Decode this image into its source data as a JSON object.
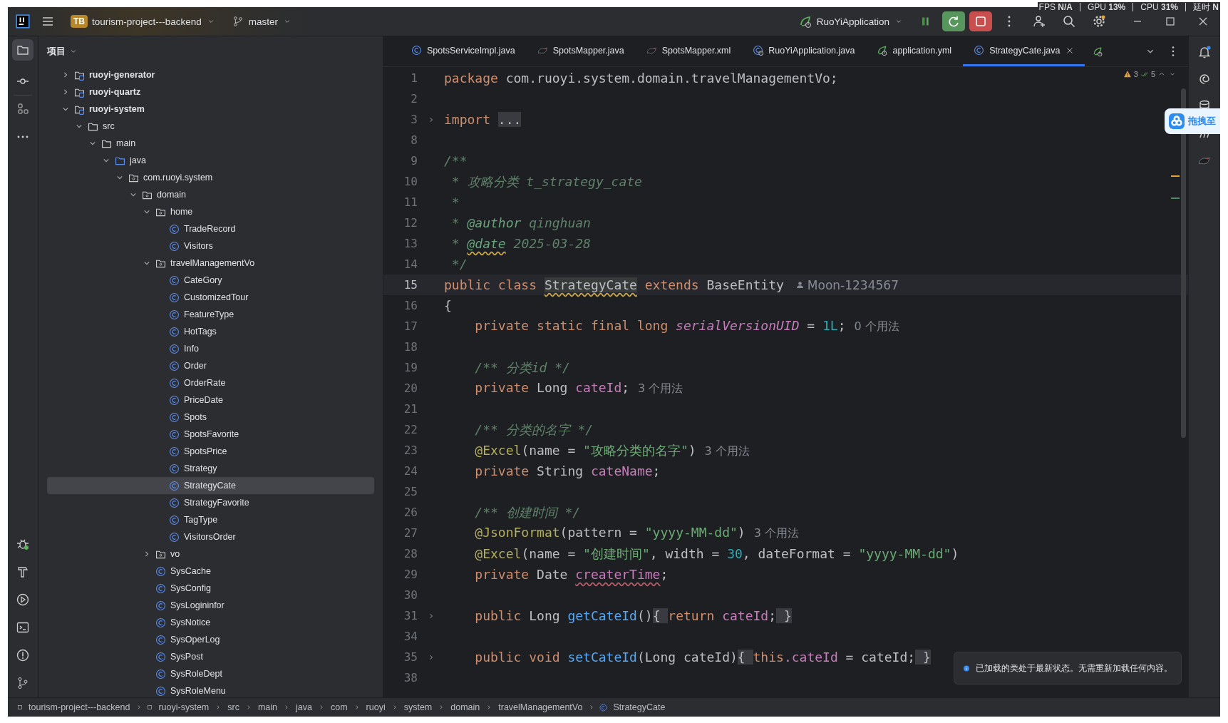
{
  "title_bar": {
    "project_badge": "TB",
    "project": "tourism-project---backend",
    "branch": "master",
    "run_config": "RuoYiApplication",
    "stats": [
      {
        "label": "FPS",
        "value": "N/A"
      },
      {
        "label": "GPU",
        "value": "13%"
      },
      {
        "label": "CPU",
        "value": "31%"
      },
      {
        "label": "延时",
        "value": "N"
      }
    ]
  },
  "project_panel": {
    "title": "项目",
    "tree": [
      {
        "label": "ruoyi-generator",
        "kind": "module",
        "expanded": false
      },
      {
        "label": "ruoyi-quartz",
        "kind": "module",
        "expanded": false
      },
      {
        "label": "ruoyi-system",
        "kind": "module",
        "expanded": true,
        "children": [
          {
            "label": "src",
            "kind": "folder",
            "expanded": true,
            "children": [
              {
                "label": "main",
                "kind": "folder",
                "expanded": true,
                "children": [
                  {
                    "label": "java",
                    "kind": "source",
                    "expanded": true,
                    "children": [
                      {
                        "label": "com.ruoyi.system",
                        "kind": "package",
                        "expanded": true,
                        "children": [
                          {
                            "label": "domain",
                            "kind": "package",
                            "expanded": true,
                            "children": [
                              {
                                "label": "home",
                                "kind": "package",
                                "expanded": true,
                                "children": [
                                  {
                                    "label": "TradeRecord",
                                    "kind": "class",
                                    "selected": false
                                  },
                                  {
                                    "label": "Visitors",
                                    "kind": "class",
                                    "selected": false
                                  }
                                ]
                              },
                              {
                                "label": "travelManagementVo",
                                "kind": "package",
                                "expanded": true,
                                "children": [
                                  {
                                    "label": "CateGory",
                                    "kind": "class",
                                    "selected": false
                                  },
                                  {
                                    "label": "CustomizedTour",
                                    "kind": "class",
                                    "selected": false
                                  },
                                  {
                                    "label": "FeatureType",
                                    "kind": "class",
                                    "selected": false
                                  },
                                  {
                                    "label": "HotTags",
                                    "kind": "class",
                                    "selected": false
                                  },
                                  {
                                    "label": "Info",
                                    "kind": "class",
                                    "selected": false
                                  },
                                  {
                                    "label": "Order",
                                    "kind": "class",
                                    "selected": false
                                  },
                                  {
                                    "label": "OrderRate",
                                    "kind": "class",
                                    "selected": false
                                  },
                                  {
                                    "label": "PriceDate",
                                    "kind": "class",
                                    "selected": false
                                  },
                                  {
                                    "label": "Spots",
                                    "kind": "class",
                                    "selected": false
                                  },
                                  {
                                    "label": "SpotsFavorite",
                                    "kind": "class",
                                    "selected": false
                                  },
                                  {
                                    "label": "SpotsPrice",
                                    "kind": "class",
                                    "selected": false
                                  },
                                  {
                                    "label": "Strategy",
                                    "kind": "class",
                                    "selected": false
                                  },
                                  {
                                    "label": "StrategyCate",
                                    "kind": "class",
                                    "selected": true
                                  },
                                  {
                                    "label": "StrategyFavorite",
                                    "kind": "class",
                                    "selected": false
                                  },
                                  {
                                    "label": "TagType",
                                    "kind": "class",
                                    "selected": false
                                  },
                                  {
                                    "label": "VisitorsOrder",
                                    "kind": "class",
                                    "selected": false
                                  }
                                ]
                              },
                              {
                                "label": "vo",
                                "kind": "package",
                                "expanded": false
                              },
                              {
                                "label": "SysCache",
                                "kind": "class",
                                "selected": false
                              },
                              {
                                "label": "SysConfig",
                                "kind": "class",
                                "selected": false
                              },
                              {
                                "label": "SysLogininfor",
                                "kind": "class",
                                "selected": false
                              },
                              {
                                "label": "SysNotice",
                                "kind": "class",
                                "selected": false
                              },
                              {
                                "label": "SysOperLog",
                                "kind": "class",
                                "selected": false
                              },
                              {
                                "label": "SysPost",
                                "kind": "class",
                                "selected": false
                              },
                              {
                                "label": "SysRoleDept",
                                "kind": "class",
                                "selected": false
                              },
                              {
                                "label": "SysRoleMenu",
                                "kind": "class",
                                "selected": false
                              }
                            ]
                          }
                        ]
                      }
                    ]
                  }
                ]
              }
            ]
          }
        ]
      }
    ]
  },
  "tabs": [
    {
      "label": "SpotsServiceImpl.java",
      "kind": "class",
      "selected": false
    },
    {
      "label": "SpotsMapper.java",
      "kind": "bird",
      "selected": false
    },
    {
      "label": "SpotsMapper.xml",
      "kind": "bird",
      "selected": false
    },
    {
      "label": "RuoYiApplication.java",
      "kind": "spring-class",
      "selected": false
    },
    {
      "label": "application.yml",
      "kind": "spring",
      "selected": false
    },
    {
      "label": "StrategyCate.java",
      "kind": "class",
      "selected": true
    }
  ],
  "editor": {
    "warnings": "3",
    "checks": "5",
    "lines": [
      {
        "number": "1",
        "folded": false,
        "current": false,
        "nested": false,
        "tokens": [
          {
            "kind": "keyword",
            "text": "package"
          },
          {
            "kind": "plain",
            "text": " com.ruoyi.system.domain.travelManagementVo;"
          }
        ]
      },
      {
        "number": "2",
        "folded": false,
        "current": false
      },
      {
        "number": "3",
        "folded": true,
        "current": false,
        "nested": false,
        "tokens": [
          {
            "kind": "keyword",
            "text": "import "
          },
          {
            "kind": "fold-box",
            "text": "..."
          }
        ]
      },
      {
        "number": "8",
        "folded": false,
        "current": false
      },
      {
        "number": "9",
        "folded": false,
        "current": false,
        "nested": false,
        "tokens": [
          {
            "kind": "doc",
            "text": "/**"
          }
        ]
      },
      {
        "number": "10",
        "folded": false,
        "current": false,
        "nested": false,
        "tokens": [
          {
            "kind": "doc",
            "text": " * 攻略分类 t_strategy_cate"
          }
        ]
      },
      {
        "number": "11",
        "folded": false,
        "current": false,
        "nested": false,
        "tokens": [
          {
            "kind": "doc",
            "text": " *"
          }
        ]
      },
      {
        "number": "12",
        "folded": false,
        "current": false,
        "nested": false,
        "tokens": [
          {
            "kind": "doc",
            "text": " * "
          },
          {
            "kind": "doc-tag",
            "text": "@author"
          },
          {
            "kind": "doc",
            "text": " qinghuan"
          }
        ]
      },
      {
        "number": "13",
        "folded": false,
        "current": false,
        "nested": false,
        "tokens": [
          {
            "kind": "doc",
            "text": " * "
          },
          {
            "kind": "doc-tag",
            "text": "@date",
            "warning": true
          },
          {
            "kind": "doc",
            "text": " 2025-03-28"
          }
        ]
      },
      {
        "number": "14",
        "folded": false,
        "current": false,
        "nested": false,
        "tokens": [
          {
            "kind": "doc",
            "text": " */"
          }
        ]
      },
      {
        "number": "15",
        "folded": false,
        "current": true,
        "nested": false,
        "tokens": [
          {
            "kind": "keyword",
            "text": "public class "
          },
          {
            "kind": "identifier",
            "text": "StrategyCate",
            "warning": true
          },
          {
            "kind": "keyword",
            "text": " extends "
          },
          {
            "kind": "plain",
            "text": "BaseEntity"
          },
          {
            "kind": "author",
            "text": "Moon-1234567"
          }
        ]
      },
      {
        "number": "16",
        "folded": false,
        "current": false,
        "nested": false,
        "tokens": [
          {
            "kind": "plain",
            "text": "{"
          }
        ]
      },
      {
        "number": "17",
        "folded": false,
        "current": false,
        "nested": true,
        "tokens": [
          {
            "kind": "keyword",
            "text": "private static final long "
          },
          {
            "kind": "static-field",
            "text": "serialVersionUID"
          },
          {
            "kind": "plain",
            "text": " = "
          },
          {
            "kind": "number",
            "text": "1L"
          },
          {
            "kind": "plain",
            "text": ";"
          },
          {
            "kind": "hint",
            "text": "0 个用法"
          }
        ]
      },
      {
        "number": "18",
        "folded": false,
        "current": false
      },
      {
        "number": "19",
        "folded": false,
        "current": false,
        "nested": true,
        "tokens": [
          {
            "kind": "doc",
            "text": "/** 分类id */"
          }
        ]
      },
      {
        "number": "20",
        "folded": false,
        "current": false,
        "nested": true,
        "tokens": [
          {
            "kind": "keyword",
            "text": "private "
          },
          {
            "kind": "plain",
            "text": "Long "
          },
          {
            "kind": "field",
            "text": "cateId"
          },
          {
            "kind": "plain",
            "text": ";"
          },
          {
            "kind": "hint",
            "text": "3 个用法"
          }
        ]
      },
      {
        "number": "21",
        "folded": false,
        "current": false
      },
      {
        "number": "22",
        "folded": false,
        "current": false,
        "nested": true,
        "tokens": [
          {
            "kind": "doc",
            "text": "/** 分类的名字 */"
          }
        ]
      },
      {
        "number": "23",
        "folded": false,
        "current": false,
        "nested": true,
        "tokens": [
          {
            "kind": "annotation",
            "text": "@Excel"
          },
          {
            "kind": "plain",
            "text": "(name = "
          },
          {
            "kind": "string",
            "text": "\"攻略分类的名字\""
          },
          {
            "kind": "plain",
            "text": ")"
          },
          {
            "kind": "hint",
            "text": "3 个用法"
          }
        ]
      },
      {
        "number": "24",
        "folded": false,
        "current": false,
        "nested": true,
        "tokens": [
          {
            "kind": "keyword",
            "text": "private "
          },
          {
            "kind": "plain",
            "text": "String "
          },
          {
            "kind": "field",
            "text": "cateName"
          },
          {
            "kind": "plain",
            "text": ";"
          }
        ]
      },
      {
        "number": "25",
        "folded": false,
        "current": false
      },
      {
        "number": "26",
        "folded": false,
        "current": false,
        "nested": true,
        "tokens": [
          {
            "kind": "doc",
            "text": "/** 创建时间 */"
          }
        ]
      },
      {
        "number": "27",
        "folded": false,
        "current": false,
        "nested": true,
        "tokens": [
          {
            "kind": "annotation",
            "text": "@JsonFormat"
          },
          {
            "kind": "plain",
            "text": "(pattern = "
          },
          {
            "kind": "string",
            "text": "\"yyyy-MM-dd\""
          },
          {
            "kind": "plain",
            "text": ")"
          },
          {
            "kind": "hint",
            "text": "3 个用法"
          }
        ]
      },
      {
        "number": "28",
        "folded": false,
        "current": false,
        "nested": true,
        "tokens": [
          {
            "kind": "annotation",
            "text": "@Excel"
          },
          {
            "kind": "plain",
            "text": "(name = "
          },
          {
            "kind": "string",
            "text": "\"创建时间\""
          },
          {
            "kind": "plain",
            "text": ", width = "
          },
          {
            "kind": "number",
            "text": "30"
          },
          {
            "kind": "plain",
            "text": ", dateFormat = "
          },
          {
            "kind": "string",
            "text": "\"yyyy-MM-dd\""
          },
          {
            "kind": "plain",
            "text": ")"
          }
        ]
      },
      {
        "number": "29",
        "folded": false,
        "current": false,
        "nested": true,
        "tokens": [
          {
            "kind": "keyword",
            "text": "private "
          },
          {
            "kind": "plain",
            "text": "Date "
          },
          {
            "kind": "field",
            "text": "createrTime",
            "typo": true
          },
          {
            "kind": "plain",
            "text": ";"
          }
        ]
      },
      {
        "number": "30",
        "folded": false,
        "current": false
      },
      {
        "number": "31",
        "folded": true,
        "current": false,
        "nested": true,
        "tokens": [
          {
            "kind": "keyword",
            "text": "public "
          },
          {
            "kind": "plain",
            "text": "Long "
          },
          {
            "kind": "method",
            "text": "getCateId"
          },
          {
            "kind": "plain",
            "text": "()"
          },
          {
            "kind": "fold-box",
            "text": "{ "
          },
          {
            "kind": "keyword",
            "text": "return "
          },
          {
            "kind": "field",
            "text": "cateId"
          },
          {
            "kind": "plain",
            "text": ";"
          },
          {
            "kind": "fold-box",
            "text": " }"
          }
        ]
      },
      {
        "number": "34",
        "folded": false,
        "current": false
      },
      {
        "number": "35",
        "folded": true,
        "current": false,
        "nested": true,
        "tokens": [
          {
            "kind": "keyword",
            "text": "public void "
          },
          {
            "kind": "method",
            "text": "setCateId"
          },
          {
            "kind": "plain",
            "text": "(Long cateId)"
          },
          {
            "kind": "fold-box",
            "text": "{ "
          },
          {
            "kind": "keyword",
            "text": "this"
          },
          {
            "kind": "field",
            "text": ".cateId"
          },
          {
            "kind": "plain",
            "text": " = cateId;"
          },
          {
            "kind": "fold-box",
            "text": " }"
          }
        ]
      },
      {
        "number": "38",
        "folded": false,
        "current": false
      }
    ]
  },
  "notification": {
    "text": "已加载的类处于最新状态。无需重新加载任何内容。"
  },
  "floating_widget": {
    "label": "拖拽至"
  },
  "breadcrumbs": [
    "tourism-project---backend",
    "ruoyi-system",
    "src",
    "main",
    "java",
    "com",
    "ruoyi",
    "system",
    "domain",
    "travelManagementVo",
    "StrategyCate"
  ]
}
